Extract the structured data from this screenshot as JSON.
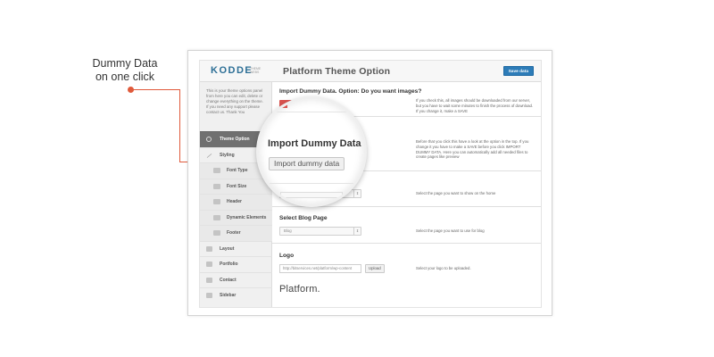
{
  "callout": {
    "line1": "Dummy Data",
    "line2": "on one click",
    "color": "#e05a3b"
  },
  "logo": {
    "text": "KODDE",
    "sub": "THEME WEBS"
  },
  "sidebar": {
    "intro": "This is your theme options panel from here you can edit, delete or change everything on the theme. If you need any support please contact us. Thank You",
    "items": [
      {
        "label": "Theme Option",
        "icon": "gear-icon"
      },
      {
        "label": "Styling",
        "icon": "brush-icon"
      },
      {
        "label": "Font Type",
        "icon": "font-type-icon"
      },
      {
        "label": "Font Size",
        "icon": "font-size-icon"
      },
      {
        "label": "Header",
        "icon": "header-icon"
      },
      {
        "label": "Dynamic Elements",
        "icon": "dynamic-elements-icon"
      },
      {
        "label": "Footer",
        "icon": "footer-icon"
      },
      {
        "label": "Layout",
        "icon": "layout-icon"
      },
      {
        "label": "Portfolio",
        "icon": "portfolio-icon"
      },
      {
        "label": "Contact",
        "icon": "contact-icon"
      },
      {
        "label": "Sidebar",
        "icon": "sidebar-icon"
      }
    ]
  },
  "header": {
    "title": "Platform  Theme Option",
    "save_label": "Save data",
    "accent": "#2d7cb8"
  },
  "sections": {
    "images": {
      "title": "Import Dummy Data. Option: Do you want images?",
      "desc": "If you check this, all images should be downloaded from our server, but you have to wait some minutes to finish the process of download. If you change it, make a SAVE"
    },
    "import": {
      "desc": "Before that you click this have a look at the option in the top. If you change it you have to make a SAVE before you click IMPORT DUMMY DATA. Here you can automatically add all needed files to create pages like preview"
    },
    "home": {
      "select_value": "Home Landing",
      "desc": "Select the page you want to show on the home"
    },
    "blog": {
      "title": "Select Blog Page",
      "select_value": "Blog",
      "desc": "Select the page you want to use for blog"
    },
    "logo": {
      "title": "Logo",
      "input_value": "http://bitservices.net/platform/wp-content",
      "upload_label": "Upload",
      "desc": "Select your logo to be uploaded."
    },
    "platform_text": "Platform."
  },
  "magnifier": {
    "title": "Import Dummy Data",
    "button_label": "Import dummy data"
  }
}
